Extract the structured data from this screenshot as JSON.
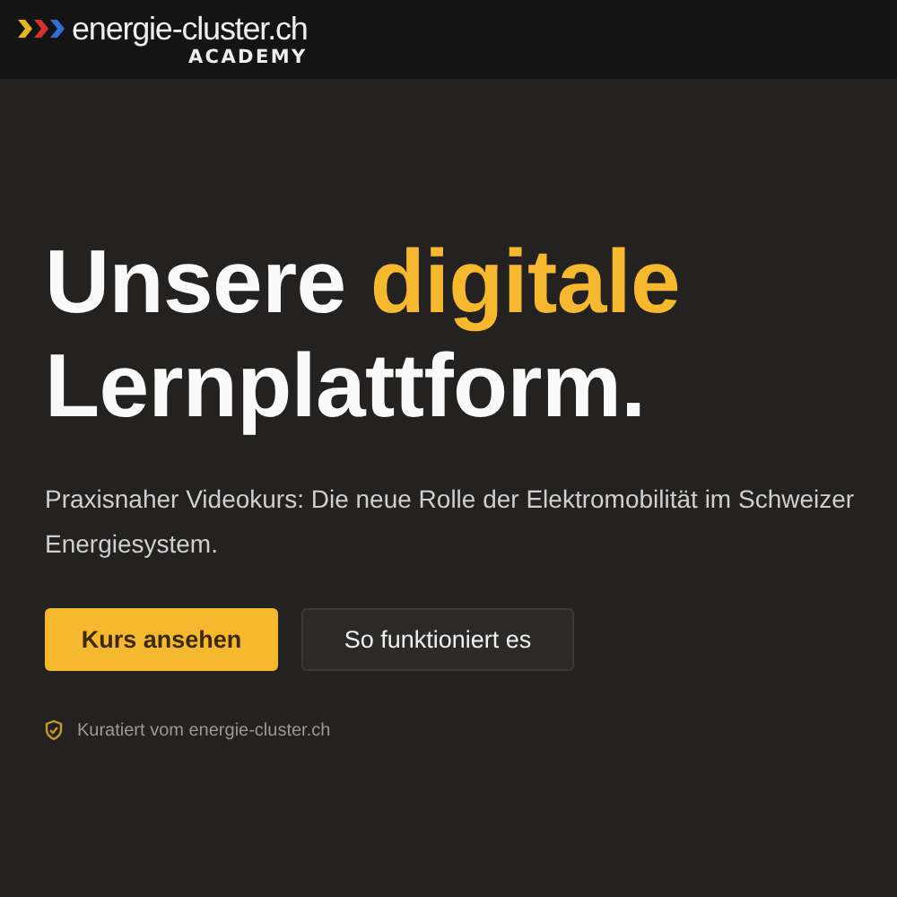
{
  "header": {
    "logo_text": "energie-cluster.ch",
    "logo_subtext": "ACADEMY"
  },
  "hero": {
    "headline": {
      "line1": "Unsere",
      "line1_highlight": "digitale",
      "line2": "Lernplattform."
    },
    "subtitle": "Praxisnaher Videokurs: Die neue Rolle der Elektromobilität im Schweizer Energiesystem.",
    "buttons": [
      {
        "label": "Kurs ansehen",
        "kind": "primary"
      },
      {
        "label": "So funktioniert es",
        "kind": "secondary"
      }
    ],
    "note": "Kuratiert vom energie-cluster.ch"
  }
}
